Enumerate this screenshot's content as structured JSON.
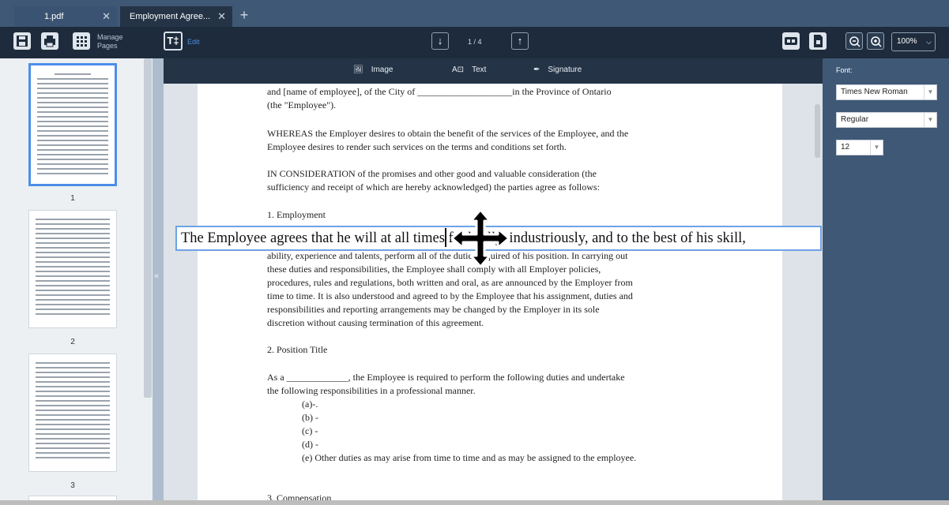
{
  "tabs": [
    {
      "label": "1.pdf"
    },
    {
      "label": "Employment Agree..."
    }
  ],
  "toolbar": {
    "manage_pages_line1": "Manage",
    "manage_pages_line2": "Pages",
    "edit_label": "Edit",
    "edit_icon_text": "T‡",
    "page_indicator": "1 / 4",
    "zoom": "100%"
  },
  "insert_bar": {
    "image_label": "Image",
    "text_label": "Text",
    "text_icon": "A⊡",
    "signature_label": "Signature"
  },
  "thumbnails": [
    {
      "page": "1"
    },
    {
      "page": "2"
    },
    {
      "page": "3"
    }
  ],
  "document": {
    "lines": [
      "and [name of employee], of the City of ____________________in the Province of Ontario",
      "(the \"Employee\").",
      "WHEREAS the Employer desires to obtain the benefit of the services of the Employee, and the",
      "Employee desires to render such services on the terms and conditions set forth.",
      "IN CONSIDERATION of the promises and other good and valuable consideration (the",
      "sufficiency and receipt of which are hereby acknowledged) the parties agree as follows:",
      "1. Employment",
      "ability, experience and talents, perform all of the duties required of his position. In carrying out",
      "these duties and responsibilities, the Employee shall comply with all Employer policies,",
      "procedures, rules and regulations, both written and oral, as are announced by the Employer from",
      "time to time. It is also understood and agreed to by the Employee that his assignment, duties and",
      "responsibilities and reporting arrangements may be changed by the Employer in its sole",
      "discretion without causing termination of this agreement.",
      "2. Position Title",
      "As a _____________, the Employee is required to perform the following duties and undertake",
      "the following responsibilities in a professional manner.",
      "(a)-.",
      "(b) -",
      "(c) -",
      "(d) -",
      "(e) Other duties as may arise from time to time and as may be assigned to the employee.",
      "3. Compensation"
    ],
    "editing_line": "The Employee agrees that he will at all times faithfully, industriously, and to the best of his skill,"
  },
  "font_panel": {
    "label": "Font:",
    "family": "Times New Roman",
    "style": "Regular",
    "size": "12"
  }
}
